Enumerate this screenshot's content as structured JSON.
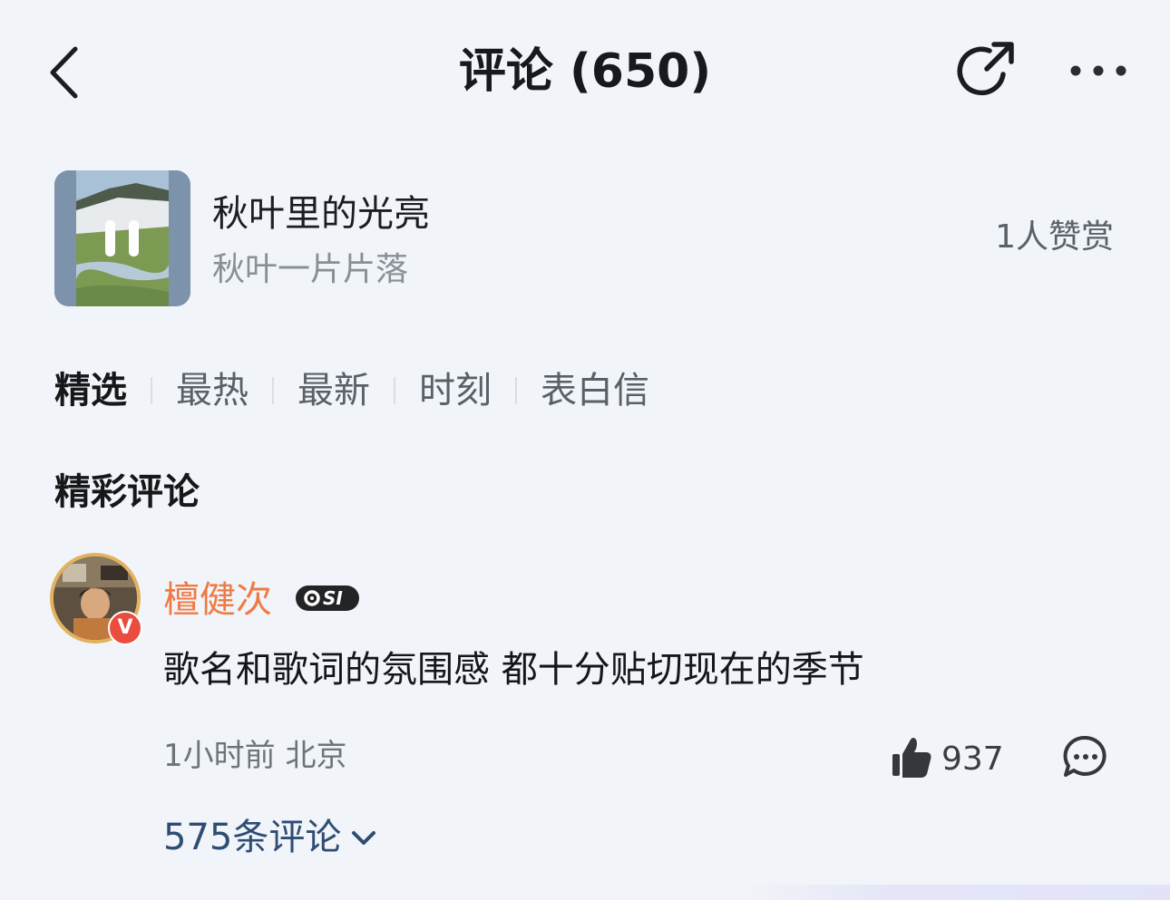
{
  "header": {
    "title": "评论 (650)",
    "back_icon": "chevron-left-icon",
    "share_icon": "share-icon",
    "more_icon": "more-dots-icon"
  },
  "song": {
    "title": "秋叶里的光亮",
    "artist": "秋叶一片片落",
    "reward_text": "1人赞赏",
    "cover_icon": "pause-icon"
  },
  "tabs": [
    {
      "label": "精选",
      "active": true
    },
    {
      "label": "最热",
      "active": false
    },
    {
      "label": "最新",
      "active": false
    },
    {
      "label": "时刻",
      "active": false
    },
    {
      "label": "表白信",
      "active": false
    }
  ],
  "section": {
    "title": "精彩评论"
  },
  "comment": {
    "username": "檀健次",
    "verified_badge": "V",
    "level_badge": "SI",
    "text": "歌名和歌词的氛围感 都十分贴切现在的季节",
    "meta": "1小时前 北京",
    "like_count": "937",
    "replies_label": "575条评论",
    "username_color": "#f07a44",
    "link_color": "#2e4d75"
  }
}
